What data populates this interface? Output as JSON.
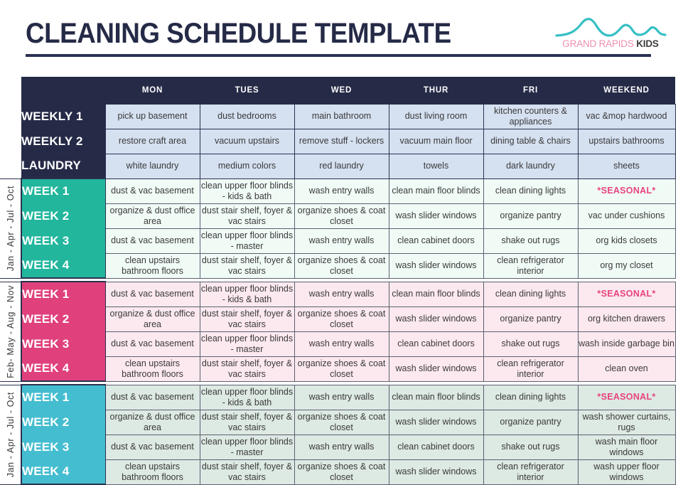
{
  "header": {
    "title": "CLEANING SCHEDULE TEMPLATE",
    "logo": {
      "brand_primary": "GRAND RAPIDS",
      "brand_secondary": "KIDS",
      "wave_color": "#35bfc4",
      "primary_color": "#ef8fae",
      "secondary_color": "#3c3c3c"
    }
  },
  "colors": {
    "navy": "#252a47",
    "teal": "#22b69d",
    "pink": "#e0417c",
    "blue": "#45bdd0",
    "weekly_cell": "#d5e0f0",
    "teal_cell": "#f0fbf6",
    "pink_cell": "#fce9ef",
    "blue_cell": "#dde9e3",
    "seasonal_text": "#e8437f"
  },
  "table": {
    "day_headers": [
      "MON",
      "TUES",
      "WED",
      "THUR",
      "FRI",
      "WEEKEND"
    ],
    "weekly_rows": [
      {
        "label": "WEEKLY 1",
        "tasks": [
          "pick up basement",
          "dust bedrooms",
          "main bathroom",
          "dust living room",
          "kitchen counters & appliances",
          "vac &mop hardwood"
        ]
      },
      {
        "label": "WEEKLY 2",
        "tasks": [
          "restore craft area",
          "vacuum upstairs",
          "remove stuff - lockers",
          "vacuum main floor",
          "dining table & chairs",
          "upstairs bathrooms"
        ]
      },
      {
        "label": "LAUNDRY",
        "tasks": [
          "white laundry",
          "medium colors",
          "red laundry",
          "towels",
          "dark laundry",
          "sheets"
        ]
      }
    ],
    "blocks": [
      {
        "months": "Jan - Apr - Jul - Oct",
        "accent": "teal",
        "rows": [
          {
            "label": "WEEK 1",
            "tasks": [
              "dust & vac basement",
              "clean upper floor blinds - kids & bath",
              "wash entry walls",
              "clean main floor blinds",
              "clean dining lights",
              "*SEASONAL*"
            ],
            "seasonal_index": 5
          },
          {
            "label": "WEEK 2",
            "tasks": [
              "organize & dust office area",
              "dust stair shelf, foyer & vac stairs",
              "organize shoes & coat closet",
              "wash slider windows",
              "organize pantry",
              "vac under cushions"
            ],
            "seasonal_index": -1
          },
          {
            "label": "WEEK 3",
            "tasks": [
              "dust & vac basement",
              "clean upper floor blinds - master",
              "wash entry walls",
              "clean cabinet doors",
              "shake out rugs",
              "org kids closets"
            ],
            "seasonal_index": -1
          },
          {
            "label": "WEEK 4",
            "tasks": [
              "clean upstairs bathroom floors",
              "dust stair shelf, foyer & vac stairs",
              "organize shoes & coat closet",
              "wash slider windows",
              "clean refrigerator interior",
              "org my closet"
            ],
            "seasonal_index": -1
          }
        ]
      },
      {
        "months": "Feb- May - Aug - Nov",
        "accent": "pink",
        "rows": [
          {
            "label": "WEEK 1",
            "tasks": [
              "dust & vac basement",
              "clean upper floor blinds - kids & bath",
              "wash entry walls",
              "clean main floor blinds",
              "clean dining lights",
              "*SEASONAL*"
            ],
            "seasonal_index": 5
          },
          {
            "label": "WEEK 2",
            "tasks": [
              "organize & dust office area",
              "dust stair shelf, foyer & vac stairs",
              "organize shoes & coat closet",
              "wash slider windows",
              "organize pantry",
              "org kitchen drawers"
            ],
            "seasonal_index": -1
          },
          {
            "label": "WEEK 3",
            "tasks": [
              "dust & vac basement",
              "clean upper floor blinds - master",
              "wash entry walls",
              "clean cabinet doors",
              "shake out rugs",
              "wash inside garbage bin"
            ],
            "seasonal_index": -1
          },
          {
            "label": "WEEK 4",
            "tasks": [
              "clean upstairs bathroom floors",
              "dust stair shelf, foyer & vac stairs",
              "organize shoes & coat closet",
              "wash slider windows",
              "clean refrigerator interior",
              "clean oven"
            ],
            "seasonal_index": -1
          }
        ]
      },
      {
        "months": "Jan - Apr - Jul - Oct",
        "accent": "blue",
        "rows": [
          {
            "label": "WEEK 1",
            "tasks": [
              "dust & vac basement",
              "clean upper floor blinds - kids & bath",
              "wash entry walls",
              "clean main floor blinds",
              "clean dining lights",
              "*SEASONAL*"
            ],
            "seasonal_index": 5
          },
          {
            "label": "WEEK 2",
            "tasks": [
              "organize & dust office area",
              "dust stair shelf, foyer & vac stairs",
              "organize shoes & coat closet",
              "wash slider windows",
              "organize pantry",
              "wash shower curtains, rugs"
            ],
            "seasonal_index": -1
          },
          {
            "label": "WEEK 3",
            "tasks": [
              "dust & vac basement",
              "clean upper floor blinds - master",
              "wash entry walls",
              "clean cabinet doors",
              "shake out rugs",
              "wash main floor windows"
            ],
            "seasonal_index": -1
          },
          {
            "label": "WEEK 4",
            "tasks": [
              "clean upstairs bathroom floors",
              "dust stair shelf, foyer & vac stairs",
              "organize shoes & coat closet",
              "wash slider windows",
              "clean refrigerator interior",
              "wash upper floor windows"
            ],
            "seasonal_index": -1
          }
        ]
      }
    ]
  }
}
